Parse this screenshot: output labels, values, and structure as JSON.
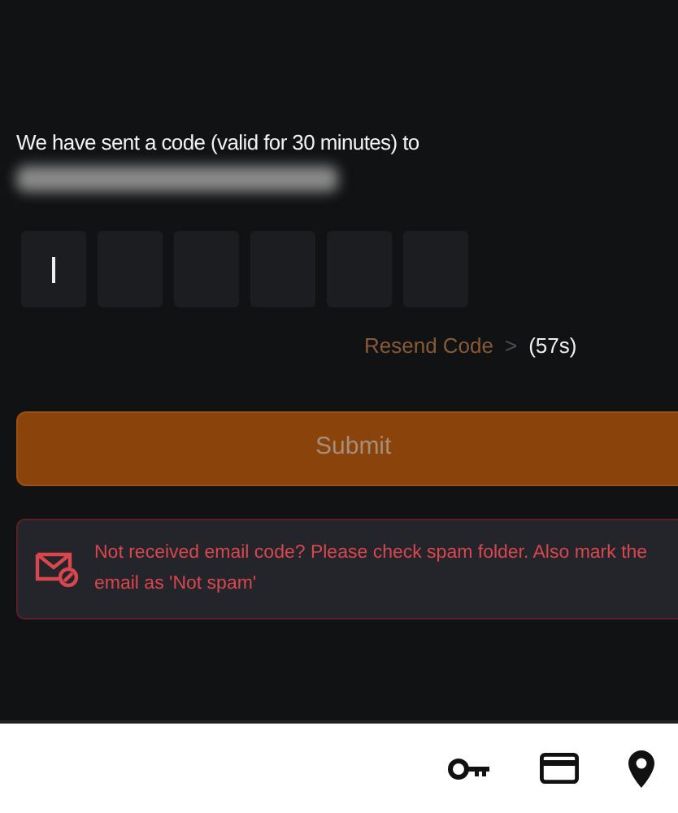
{
  "message": "We have sent a code (valid for 30 minutes) to",
  "email_hidden": true,
  "code_boxes": [
    {
      "focused": true
    },
    {
      "focused": false
    },
    {
      "focused": false
    },
    {
      "focused": false
    },
    {
      "focused": false
    },
    {
      "focused": false
    }
  ],
  "resend": {
    "label": "Resend Code",
    "arrow": ">",
    "countdown": "(57s)"
  },
  "submit": {
    "label": "Submit",
    "disabled": true
  },
  "notice": {
    "text": "Not received email code? Please check spam folder. Also mark the email as 'Not spam'"
  },
  "bottom_bar": [
    {
      "kind": "key"
    },
    {
      "kind": "card"
    },
    {
      "kind": "pin"
    }
  ]
}
